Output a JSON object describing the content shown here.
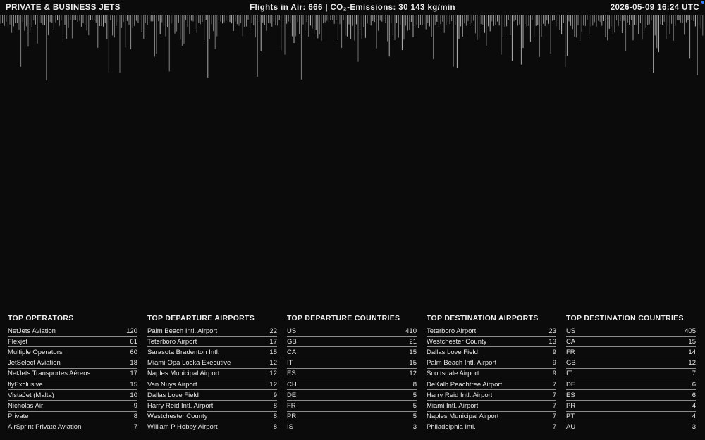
{
  "header": {
    "title": "PRIVATE & BUSINESS JETS",
    "stats": "Flights in Air: 666 | CO₂-Emissions: 30 143 kg/min",
    "datetime": "2026-05-09 16:24 UTC"
  },
  "colors": {
    "background": "#0b0b0b",
    "bars": "#bdbdbd",
    "text": "#e9e9e9",
    "live_dot": "#3a7bff"
  },
  "tables": [
    {
      "title": "TOP OPERATORS",
      "rows": [
        {
          "label": "NetJets Aviation",
          "value": "120"
        },
        {
          "label": "Flexjet",
          "value": "61"
        },
        {
          "label": "Multiple Operators",
          "value": "60"
        },
        {
          "label": "JetSelect Aviation",
          "value": "18"
        },
        {
          "label": "NetJets Transportes Aéreos",
          "value": "17"
        },
        {
          "label": "flyExclusive",
          "value": "15"
        },
        {
          "label": "VistaJet (Malta)",
          "value": "10"
        },
        {
          "label": "Nicholas Air",
          "value": "9"
        },
        {
          "label": "Private",
          "value": "8"
        },
        {
          "label": "AirSprint Private Aviation",
          "value": "7"
        }
      ]
    },
    {
      "title": "TOP DEPARTURE AIRPORTS",
      "rows": [
        {
          "label": "Palm Beach Intl. Airport",
          "value": "22"
        },
        {
          "label": "Teterboro Airport",
          "value": "17"
        },
        {
          "label": "Sarasota Bradenton Intl.",
          "value": "15"
        },
        {
          "label": "Miami-Opa Locka Executive",
          "value": "12"
        },
        {
          "label": "Naples Municipal Airport",
          "value": "12"
        },
        {
          "label": "Van Nuys Airport",
          "value": "12"
        },
        {
          "label": "Dallas Love Field",
          "value": "9"
        },
        {
          "label": "Harry Reid Intl. Airport",
          "value": "8"
        },
        {
          "label": "Westchester County",
          "value": "8"
        },
        {
          "label": "William P Hobby Airport",
          "value": "8"
        }
      ]
    },
    {
      "title": "TOP DEPARTURE COUNTRIES",
      "rows": [
        {
          "label": "US",
          "value": "410"
        },
        {
          "label": "GB",
          "value": "21"
        },
        {
          "label": "CA",
          "value": "15"
        },
        {
          "label": "IT",
          "value": "15"
        },
        {
          "label": "ES",
          "value": "12"
        },
        {
          "label": "CH",
          "value": "8"
        },
        {
          "label": "DE",
          "value": "5"
        },
        {
          "label": "FR",
          "value": "5"
        },
        {
          "label": "PR",
          "value": "5"
        },
        {
          "label": "IS",
          "value": "3"
        }
      ]
    },
    {
      "title": "TOP DESTINATION AIRPORTS",
      "rows": [
        {
          "label": "Teterboro Airport",
          "value": "23"
        },
        {
          "label": "Westchester County",
          "value": "13"
        },
        {
          "label": "Dallas Love Field",
          "value": "9"
        },
        {
          "label": "Palm Beach Intl. Airport",
          "value": "9"
        },
        {
          "label": "Scottsdale Airport",
          "value": "9"
        },
        {
          "label": "DeKalb Peachtree Airport",
          "value": "7"
        },
        {
          "label": "Harry Reid Intl. Airport",
          "value": "7"
        },
        {
          "label": "Miami Intl. Airport",
          "value": "7"
        },
        {
          "label": "Naples Municipal Airport",
          "value": "7"
        },
        {
          "label": "Philadelphia Intl.",
          "value": "7"
        }
      ]
    },
    {
      "title": "TOP DESTINATION COUNTRIES",
      "rows": [
        {
          "label": "US",
          "value": "405"
        },
        {
          "label": "CA",
          "value": "15"
        },
        {
          "label": "FR",
          "value": "14"
        },
        {
          "label": "GB",
          "value": "12"
        },
        {
          "label": "IT",
          "value": "7"
        },
        {
          "label": "DE",
          "value": "6"
        },
        {
          "label": "ES",
          "value": "6"
        },
        {
          "label": "PR",
          "value": "4"
        },
        {
          "label": "PT",
          "value": "4"
        },
        {
          "label": "AU",
          "value": "3"
        }
      ]
    }
  ]
}
